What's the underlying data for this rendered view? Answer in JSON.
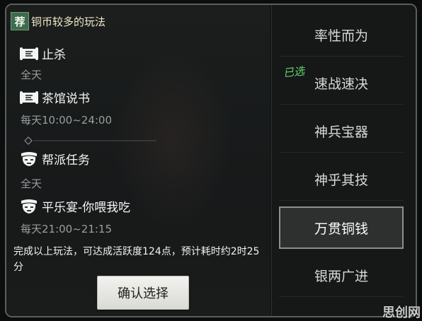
{
  "header": {
    "badge": "荐",
    "title": "铜币较多的玩法"
  },
  "activities": [
    {
      "name": "止杀",
      "time": "全天",
      "icon": "scroll-icon"
    },
    {
      "name": "茶馆说书",
      "time": "每天10:00~24:00",
      "icon": "scroll-icon"
    },
    {
      "name": "帮派任务",
      "time": "全天",
      "icon": "mask-icon"
    },
    {
      "name": "平乐宴-你喂我吃",
      "time": "每天21:00~21:15",
      "icon": "mask-icon"
    }
  ],
  "footer": {
    "text": "完成以上玩法，可达成活跃度124点，预计耗时约2时25分"
  },
  "confirm_label": "确认选择",
  "options": [
    {
      "label": "率性而为"
    },
    {
      "label": "速战速决"
    },
    {
      "label": "神兵宝器"
    },
    {
      "label": "神乎其技"
    },
    {
      "label": "万贯铜钱"
    },
    {
      "label": "银两广进"
    }
  ],
  "picked_tag": "已选",
  "selected_option": "万贯铜钱",
  "watermark": "思创网",
  "colors": {
    "accent_green": "#3e6a4d",
    "picked_green": "#67d36e",
    "title_gold": "#f3e9c6"
  }
}
